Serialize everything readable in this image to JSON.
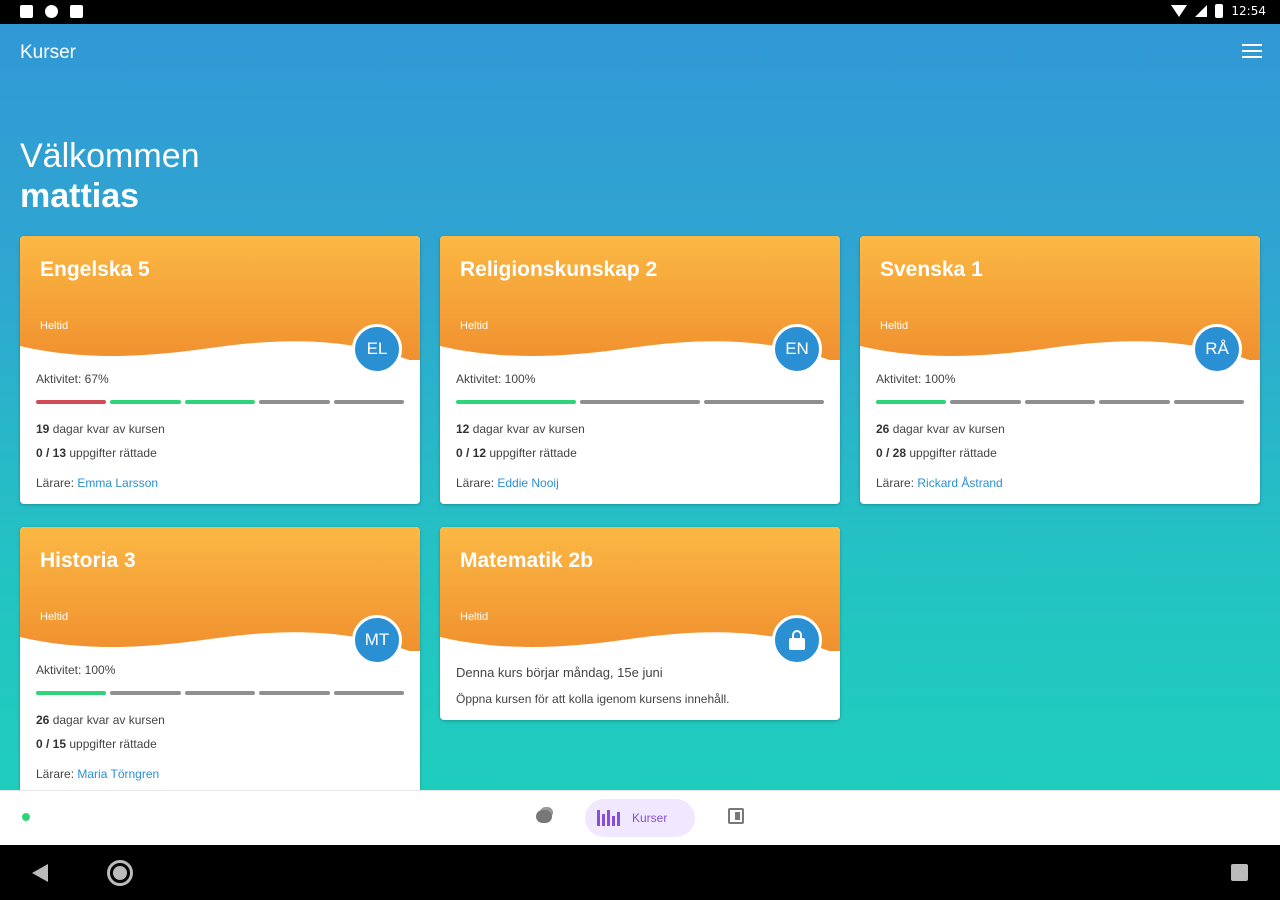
{
  "status_bar": {
    "time": "12:54"
  },
  "app_bar": {
    "title": "Kurser"
  },
  "welcome": {
    "greeting": "Välkommen",
    "name": "mattias"
  },
  "colors": {
    "header_top": "#fbb844",
    "header_bottom": "#f08f2e",
    "badge": "#2b8fd3",
    "progress_done": "#2ed47a",
    "progress_low": "#d14b55",
    "progress_empty": "#8f8f8f",
    "nav_active": "#8a4fd8"
  },
  "cards": [
    {
      "title": "Engelska 5",
      "subtitle": "Heltid",
      "badge": "EL",
      "activity": "Aktivitet: 67%",
      "progress": [
        "low",
        "done",
        "done",
        "empty",
        "empty"
      ],
      "days_left": "19",
      "days_label": " dagar kvar av kursen",
      "tasks": "0 / 13",
      "tasks_label": " uppgifter rättade",
      "teacher_label": "Lärare: ",
      "teacher": "Emma Larsson"
    },
    {
      "title": "Religionskunskap 2",
      "subtitle": "Heltid",
      "badge": "EN",
      "activity": "Aktivitet: 100%",
      "progress": [
        "done",
        "empty",
        "empty"
      ],
      "days_left": "12",
      "days_label": " dagar kvar av kursen",
      "tasks": "0 / 12",
      "tasks_label": " uppgifter rättade",
      "teacher_label": "Lärare: ",
      "teacher": "Eddie Nooij"
    },
    {
      "title": "Svenska 1",
      "subtitle": "Heltid",
      "badge": "RÅ",
      "activity": "Aktivitet: 100%",
      "progress": [
        "done",
        "empty",
        "empty",
        "empty",
        "empty"
      ],
      "days_left": "26",
      "days_label": " dagar kvar av kursen",
      "tasks": "0 / 28",
      "tasks_label": " uppgifter rättade",
      "teacher_label": "Lärare: ",
      "teacher": "Rickard Åstrand"
    },
    {
      "title": "Historia 3",
      "subtitle": "Heltid",
      "badge": "MT",
      "activity": "Aktivitet: 100%",
      "progress": [
        "done",
        "empty",
        "empty",
        "empty",
        "empty"
      ],
      "days_left": "26",
      "days_label": " dagar kvar av kursen",
      "tasks": "0 / 15",
      "tasks_label": " uppgifter rättade",
      "teacher_label": "Lärare: ",
      "teacher": "Maria Törngren"
    },
    {
      "title": "Matematik 2b",
      "subtitle": "Heltid",
      "badge_icon": "lock-icon",
      "info_start": "Denna kurs börjar måndag, 15e juni",
      "info_open": "Öppna kursen för att kolla igenom kursens innehåll."
    }
  ],
  "bottom_nav": {
    "items": [
      {
        "icon": "chat-icon"
      },
      {
        "icon": "library-icon",
        "label": "Kurser",
        "active": true
      },
      {
        "icon": "book-icon"
      }
    ]
  },
  "system_nav": {
    "back": "back-icon",
    "home": "home-icon",
    "recents": "recents-icon"
  }
}
